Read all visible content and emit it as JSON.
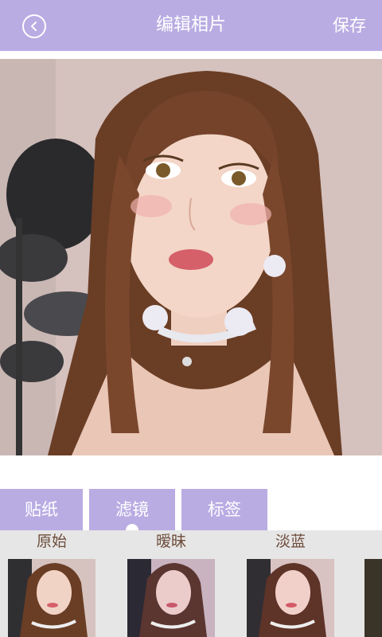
{
  "header": {
    "title": "编辑相片",
    "save_label": "保存",
    "back_icon": "chevron-left-icon"
  },
  "colors": {
    "accent": "#b9ace3",
    "strip_bg": "#e6e6e6",
    "filter_label": "#6d4b3a"
  },
  "tool_tabs": [
    {
      "label": "贴纸",
      "active": false
    },
    {
      "label": "滤镜",
      "active": true
    },
    {
      "label": "标签",
      "active": false
    }
  ],
  "filters": [
    {
      "label": "原始"
    },
    {
      "label": "暧昧"
    },
    {
      "label": "淡蓝"
    },
    {
      "label": ""
    }
  ]
}
